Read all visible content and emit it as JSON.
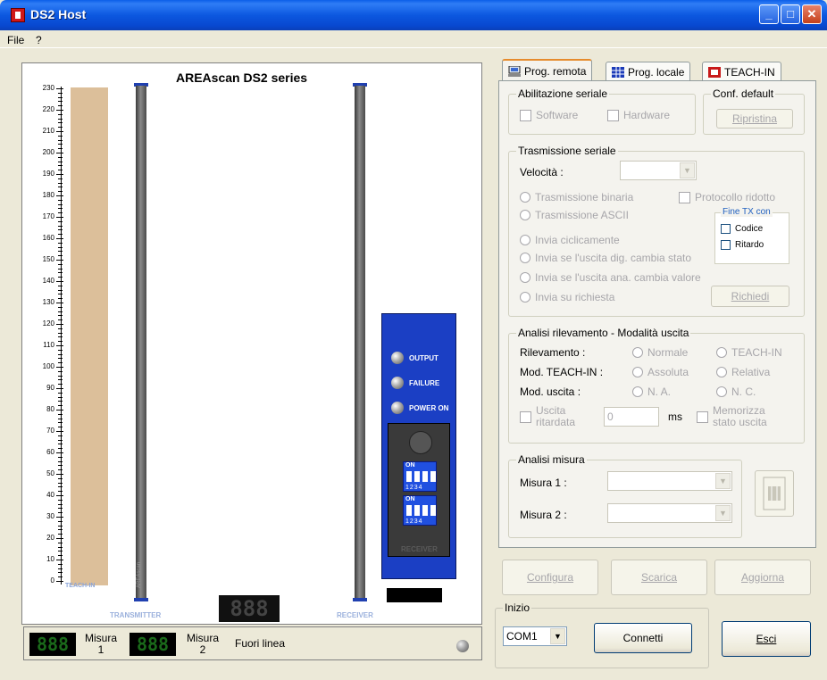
{
  "window": {
    "title": "DS2 Host",
    "minimize": "_",
    "maximize": "□",
    "close": "✕"
  },
  "menu": {
    "file": "File",
    "help": "?"
  },
  "scene": {
    "title": "AREAscan DS2 series",
    "y_ticks": [
      "230",
      "220",
      "210",
      "200",
      "190",
      "180",
      "170",
      "160",
      "150",
      "140",
      "130",
      "120",
      "110",
      "100",
      "90",
      "80",
      "70",
      "60",
      "50",
      "40",
      "30",
      "20",
      "10",
      "0"
    ],
    "teach_label": "TEACH-IN",
    "transmitter_label": "TRANSMITTER",
    "receiver_label": "RECEIVER",
    "rod_text": "AREAscan",
    "center_display": "888",
    "receiver_unit": {
      "leds": [
        "OUTPUT",
        "FAILURE",
        "POWER ON"
      ],
      "dip_on": "ON",
      "dip_numbers": "1234",
      "name": "RECEIVER"
    }
  },
  "status": {
    "display1": "888",
    "label1": "Misura",
    "num1": "1",
    "display2": "888",
    "label2": "Misura",
    "num2": "2",
    "state": "Fuori linea"
  },
  "tabs": [
    "Prog. remota",
    "Prog. locale",
    "TEACH-IN"
  ],
  "serial_enable": {
    "title": "Abilitazione seriale",
    "software": "Software",
    "hardware": "Hardware"
  },
  "conf_default": {
    "title": "Conf. default",
    "restore": "Ripristina"
  },
  "serial_tx": {
    "title": "Trasmissione seriale",
    "speed_label": "Velocità :",
    "speed_value": "",
    "binary": "Trasmissione binaria",
    "ascii": "Trasmissione ASCII",
    "reduced_protocol": "Protocollo ridotto",
    "fine_tx_title": "Fine TX con",
    "code": "Codice",
    "delay": "Ritardo",
    "cyclic": "Invia ciclicamente",
    "on_dig_change": "Invia se l'uscita dig. cambia stato",
    "on_ana_change": "Invia se l'uscita ana. cambia valore",
    "on_request": "Invia su richiesta",
    "request_btn": "Richiedi"
  },
  "analysis": {
    "title": "Analisi rilevamento - Modalità uscita",
    "detection_label": "Rilevamento :",
    "normal": "Normale",
    "teach_in": "TEACH-IN",
    "teach_mode_label": "Mod. TEACH-IN :",
    "absolute": "Assoluta",
    "relative": "Relativa",
    "output_mode_label": "Mod. uscita :",
    "na": "N. A.",
    "nc": "N. C.",
    "delayed_output": "Uscita ritardata",
    "delay_value": "0",
    "ms": "ms",
    "store_state": "Memorizza stato uscita"
  },
  "measure": {
    "title": "Analisi misura",
    "m1_label": "Misura 1 :",
    "m2_label": "Misura 2 :",
    "m1_value": "",
    "m2_value": ""
  },
  "actions": {
    "configure": "Configura",
    "download": "Scarica",
    "update": "Aggiorna"
  },
  "start": {
    "title": "Inizio",
    "port": "COM1",
    "connect": "Connetti",
    "exit": "Esci"
  },
  "colors": {
    "titlebar": "#0a58e0",
    "receiver_body": "#1b3fc4",
    "teach_bar": "#dcbf9a",
    "tab_accent": "#e68b2c"
  }
}
